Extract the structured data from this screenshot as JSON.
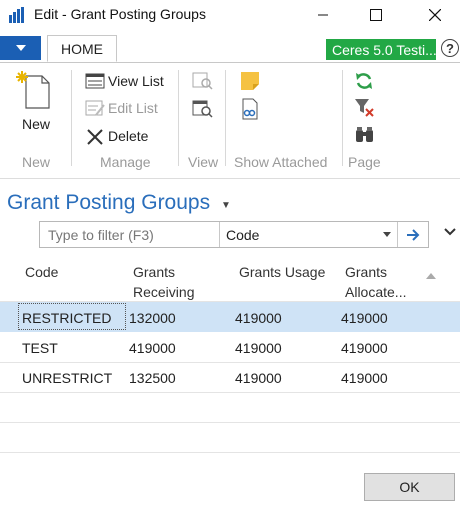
{
  "window": {
    "title": "Edit - Grant Posting Groups"
  },
  "ribbon": {
    "tab": "HOME",
    "company": "Ceres 5.0 Testi...",
    "help": "?",
    "new_label": "New",
    "view_list": "View List",
    "edit_list": "Edit List",
    "delete": "Delete",
    "groups": [
      "New",
      "Manage",
      "View",
      "Show Attached",
      "Page"
    ]
  },
  "page": {
    "title": "Grant Posting Groups"
  },
  "filter": {
    "placeholder": "Type to filter (F3)",
    "field": "Code"
  },
  "table": {
    "headers": [
      [
        "Code"
      ],
      [
        "Grants",
        "Receiving"
      ],
      [
        "Grants Usage"
      ],
      [
        "Grants",
        "Allocate..."
      ]
    ],
    "rows": [
      [
        "RESTRICTED",
        "132000",
        "419000",
        "419000"
      ],
      [
        "TEST",
        "419000",
        "419000",
        "419000"
      ],
      [
        "UNRESTRICT",
        "132500",
        "419000",
        "419000"
      ]
    ]
  },
  "footer": {
    "ok": "OK"
  },
  "colors": {
    "accent": "#2a6ebb",
    "app_menu": "#1b5fb4",
    "company_badge": "#22a845",
    "selected_row": "#cfe3f6"
  }
}
